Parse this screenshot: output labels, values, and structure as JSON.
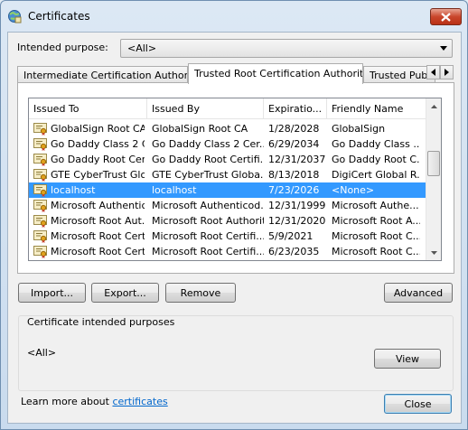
{
  "window": {
    "title": "Certificates"
  },
  "purpose": {
    "label": "Intended purpose:",
    "value": "<All>"
  },
  "tabs": [
    {
      "label": "Intermediate Certification Authorities"
    },
    {
      "label": "Trusted Root Certification Authorities"
    },
    {
      "label": "Trusted Publishers"
    }
  ],
  "list": {
    "columns": [
      "Issued To",
      "Issued By",
      "Expiratio...",
      "Friendly Name"
    ],
    "rows": [
      [
        "GlobalSign Root CA",
        "GlobalSign Root CA",
        "1/28/2028",
        "GlobalSign"
      ],
      [
        "Go Daddy Class 2 C...",
        "Go Daddy Class 2 Cer...",
        "6/29/2034",
        "Go Daddy Class ..."
      ],
      [
        "Go Daddy Root Cer...",
        "Go Daddy Root Certifi...",
        "12/31/2037",
        "Go Daddy Root C..."
      ],
      [
        "GTE CyberTrust Glo...",
        "GTE CyberTrust Globa...",
        "8/13/2018",
        "DigiCert Global R..."
      ],
      [
        "localhost",
        "localhost",
        "7/23/2026",
        "<None>"
      ],
      [
        "Microsoft Authentic...",
        "Microsoft Authenticod...",
        "12/31/1999",
        "Microsoft Authe..."
      ],
      [
        "Microsoft Root Aut...",
        "Microsoft Root Authority",
        "12/31/2020",
        "Microsoft Root A..."
      ],
      [
        "Microsoft Root Cert...",
        "Microsoft Root Certifi...",
        "5/9/2021",
        "Microsoft Root C..."
      ],
      [
        "Microsoft Root Cert...",
        "Microsoft Root Certifi...",
        "6/23/2035",
        "Microsoft Root C..."
      ]
    ],
    "selected_index": 4
  },
  "buttons": {
    "import": "Import...",
    "export": "Export...",
    "remove": "Remove",
    "advanced": "Advanced",
    "view": "View",
    "close": "Close"
  },
  "purposes_group": {
    "title": "Certificate intended purposes",
    "value": "<All>"
  },
  "footer": {
    "learn_prefix": "Learn more about ",
    "learn_link": "certificates"
  },
  "colors": {
    "selection": "#3399ff",
    "link": "#0066cc",
    "close_button": "#c9462c"
  }
}
